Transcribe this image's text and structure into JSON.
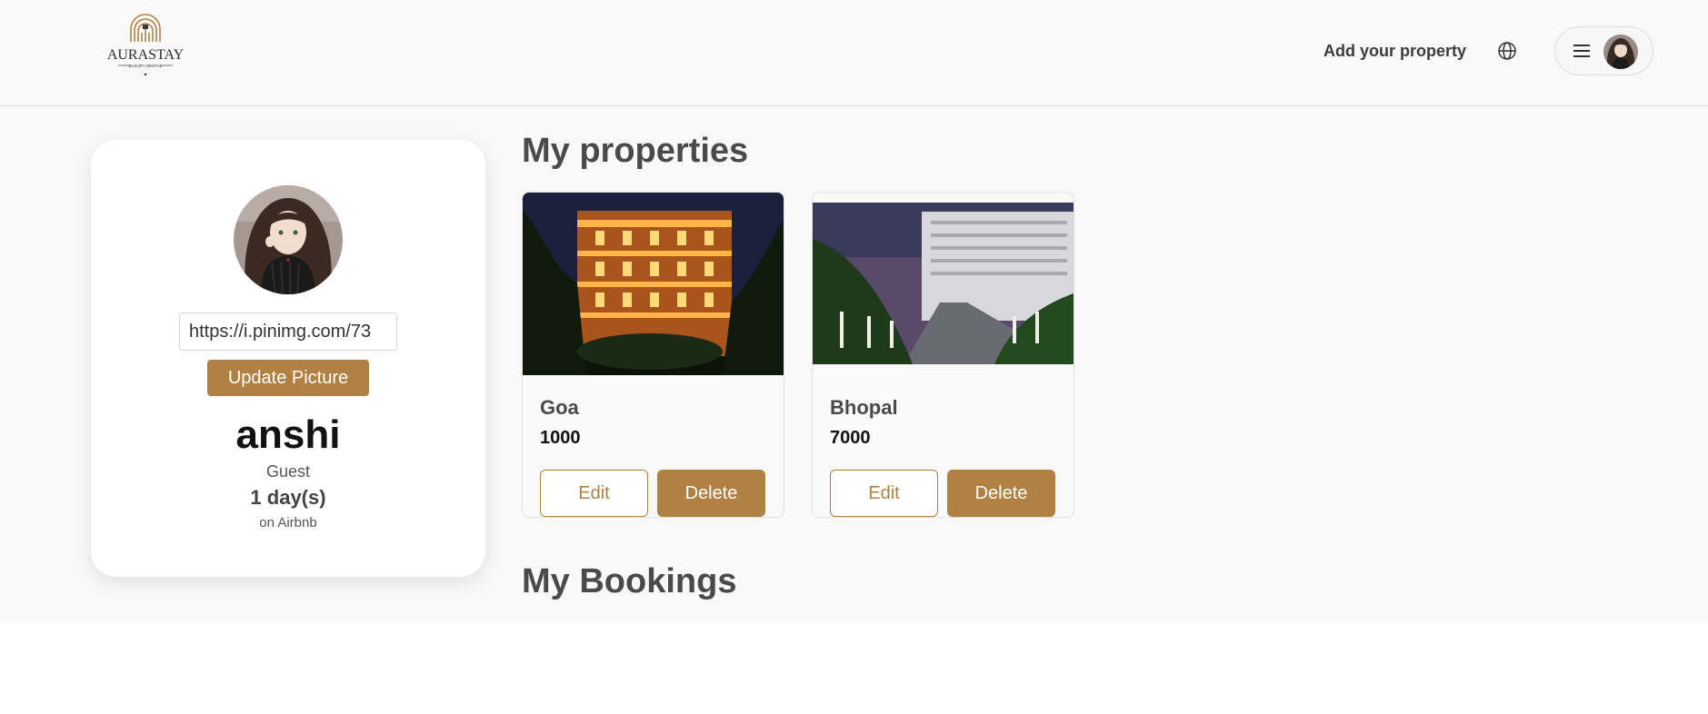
{
  "header": {
    "logo_text": "AURASTAY",
    "logo_tagline": "LUXURY RENTAL",
    "add_property_label": "Add your property",
    "globe_icon": "globe-icon",
    "menu_icon": "hamburger-menu-icon"
  },
  "profile": {
    "picture_url_value": "https://i.pinimg.com/73",
    "update_button_label": "Update Picture",
    "name": "anshi",
    "role": "Guest",
    "tenure": "1 day(s)",
    "tenure_suffix": "on Airbnb"
  },
  "properties_section": {
    "title": "My properties",
    "items": [
      {
        "name": "Goa",
        "price": "1000",
        "edit_label": "Edit",
        "delete_label": "Delete"
      },
      {
        "name": "Bhopal",
        "price": "7000",
        "edit_label": "Edit",
        "delete_label": "Delete"
      }
    ]
  },
  "bookings_section": {
    "title": "My Bookings"
  },
  "colors": {
    "accent": "#b08142",
    "header_bg": "#f9f9f9",
    "heading_text": "#4a4a4a"
  }
}
